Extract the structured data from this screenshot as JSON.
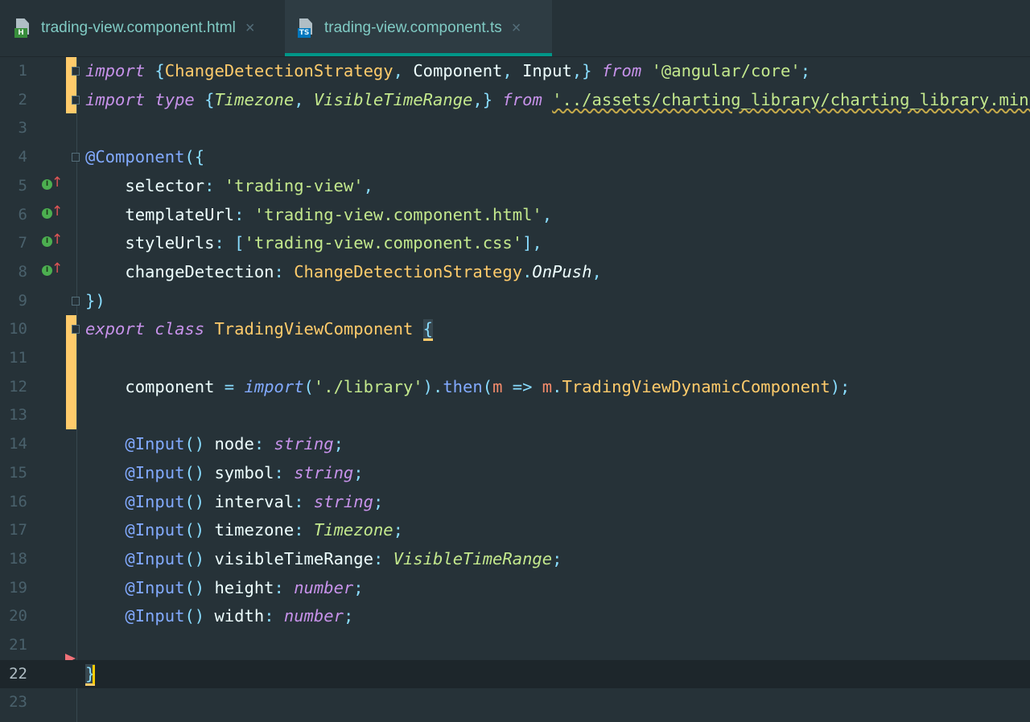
{
  "tabs": [
    {
      "label": "trading-view.component.html",
      "badge": "H",
      "icon": "html-file-icon",
      "close": "×"
    },
    {
      "label": "trading-view.component.ts",
      "badge": "TS",
      "icon": "typescript-file-icon",
      "close": "×"
    }
  ],
  "active_tab": 1,
  "line_numbers": [
    "1",
    "2",
    "3",
    "4",
    "5",
    "6",
    "7",
    "8",
    "9",
    "10",
    "11",
    "12",
    "13",
    "14",
    "15",
    "16",
    "17",
    "18",
    "19",
    "20",
    "21",
    "22",
    "23"
  ],
  "code": {
    "l1": [
      "import",
      " {",
      "ChangeDetectionStrategy",
      ", ",
      "Component",
      ", ",
      "Input",
      ",}",
      " ",
      "from",
      " ",
      "'@angular/core'",
      ";"
    ],
    "l2": [
      "import",
      " ",
      "type",
      " {",
      "Timezone",
      ", ",
      "VisibleTimeRange",
      ",}",
      " ",
      "from",
      " ",
      "'../assets/charting_library/charting_library.min'",
      ";"
    ],
    "l4": [
      "@Component",
      "({"
    ],
    "l5": [
      "    selector",
      ": ",
      "'trading-view'",
      ","
    ],
    "l6": [
      "    templateUrl",
      ": ",
      "'trading-view.component.html'",
      ","
    ],
    "l7": [
      "    styleUrls",
      ": ",
      "[",
      "'trading-view.component.css'",
      "]",
      ","
    ],
    "l8": [
      "    changeDetection",
      ": ",
      "ChangeDetectionStrategy",
      ".",
      "OnPush",
      ","
    ],
    "l9": [
      "})"
    ],
    "l10": [
      "export",
      " ",
      "class",
      " ",
      "TradingViewComponent",
      " ",
      "{"
    ],
    "l12": [
      "    component",
      " = ",
      "import",
      "(",
      "'./library'",
      ").",
      "then",
      "(",
      "m",
      " => ",
      "m",
      ".",
      "TradingViewDynamicComponent",
      ");"
    ],
    "inputs": [
      {
        "dec": "@Input",
        "par": "()",
        "name": " node",
        "colon": ": ",
        "type": "string",
        "semi": ";"
      },
      {
        "dec": "@Input",
        "par": "()",
        "name": " symbol",
        "colon": ": ",
        "type": "string",
        "semi": ";"
      },
      {
        "dec": "@Input",
        "par": "()",
        "name": " interval",
        "colon": ": ",
        "type": "string",
        "semi": ";"
      },
      {
        "dec": "@Input",
        "par": "()",
        "name": " timezone",
        "colon": ": ",
        "type": "Timezone",
        "semi": ";"
      },
      {
        "dec": "@Input",
        "par": "()",
        "name": " visibleTimeRange",
        "colon": ": ",
        "type": "VisibleTimeRange",
        "semi": ";"
      },
      {
        "dec": "@Input",
        "par": "()",
        "name": " height",
        "colon": ": ",
        "type": "number",
        "semi": ";"
      },
      {
        "dec": "@Input",
        "par": "()",
        "name": " width",
        "colon": ": ",
        "type": "number",
        "semi": ";"
      }
    ],
    "l22": "}"
  },
  "gutter_marker_badge": "I",
  "gutter_marker_arrow": "↑",
  "colors": {
    "background": "#263238",
    "keyword": "#c792ea",
    "string": "#c3e88d",
    "decorator": "#82aaff",
    "class": "#ffcb6b",
    "punct": "#89ddff",
    "param": "#f78c6c",
    "accent": "#009688"
  }
}
